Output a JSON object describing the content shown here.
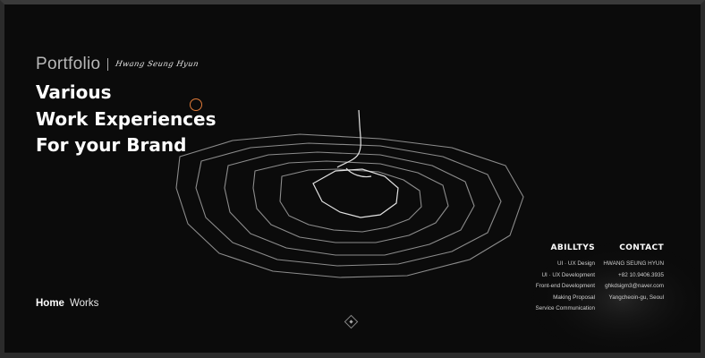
{
  "hero": {
    "portfolio_label": "Portfolio",
    "signature": "Hwang Seung Hyun",
    "headline": [
      "Various",
      "Work Experiences",
      "For your Brand"
    ]
  },
  "nav": {
    "home": "Home",
    "works": "Works"
  },
  "abilities": {
    "title": "ABILLTYS",
    "items": [
      "UI · UX Design",
      "UI · UX Development",
      "Front-end Development",
      "Making Proposal",
      "Service Communication"
    ]
  },
  "contact": {
    "title": "CONTACT",
    "items": [
      "HWANG SEUNG HYUN",
      "+82 10.9406.3935",
      "ghkdsigm3@naver.com",
      "Yangcheoin-gu, Seoul"
    ]
  },
  "colors": {
    "background": "#0b0b0b",
    "accent": "#e07b39",
    "text": "#ffffff"
  },
  "icons": {
    "scroll_down": "diamond-scroll-icon"
  }
}
